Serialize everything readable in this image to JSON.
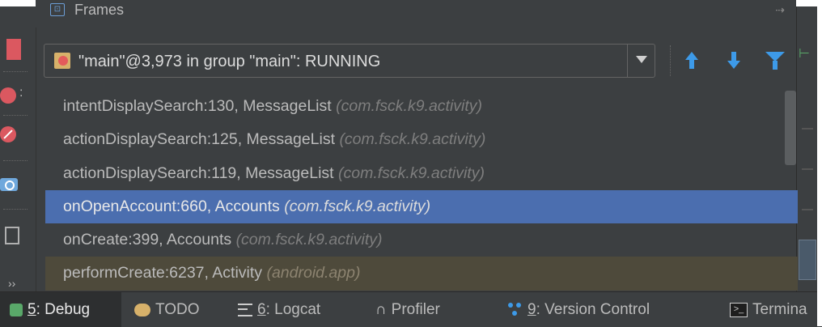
{
  "panel": {
    "title": "Frames",
    "header_icon": "frames-icon",
    "pin_icon": "pin-icon"
  },
  "thread_selector": {
    "icon": "thread-suspended-icon",
    "value": "\"main\"@3,973 in group \"main\": RUNNING"
  },
  "toolbar": {
    "icons": [
      "arrow-up-icon",
      "arrow-down-icon",
      "filter-icon"
    ]
  },
  "frames": [
    {
      "method": "intentDisplaySearch:130, MessageList",
      "package": "(com.fsck.k9.activity)",
      "state": "normal"
    },
    {
      "method": "actionDisplaySearch:125, MessageList",
      "package": "(com.fsck.k9.activity)",
      "state": "normal"
    },
    {
      "method": "actionDisplaySearch:119, MessageList",
      "package": "(com.fsck.k9.activity)",
      "state": "normal"
    },
    {
      "method": "onOpenAccount:660, Accounts",
      "package": "(com.fsck.k9.activity)",
      "state": "selected"
    },
    {
      "method": "onCreate:399, Accounts",
      "package": "(com.fsck.k9.activity)",
      "state": "normal"
    },
    {
      "method": "performCreate:6237, Activity",
      "package": "(android.app)",
      "state": "library"
    }
  ],
  "bottom_tabs": {
    "debug": {
      "mnemonic": "5",
      "rest": ": Debug",
      "icon": "debug-icon"
    },
    "todo": {
      "label": "TODO",
      "icon": "todo-icon"
    },
    "logcat": {
      "mnemonic": "6",
      "rest": ": Logcat",
      "icon": "logcat-icon"
    },
    "profiler": {
      "label": "Profiler",
      "icon": "profiler-icon"
    },
    "vcs": {
      "mnemonic": "9",
      "rest": ": Version Control",
      "icon": "vcs-icon"
    },
    "terminal": {
      "label": "Termina",
      "icon": "terminal-icon"
    }
  },
  "colors": {
    "selection": "#4b6eaf",
    "library_row": "#4e4a3b",
    "accent_blue": "#3d9ae8",
    "stop_red": "#db5860"
  }
}
